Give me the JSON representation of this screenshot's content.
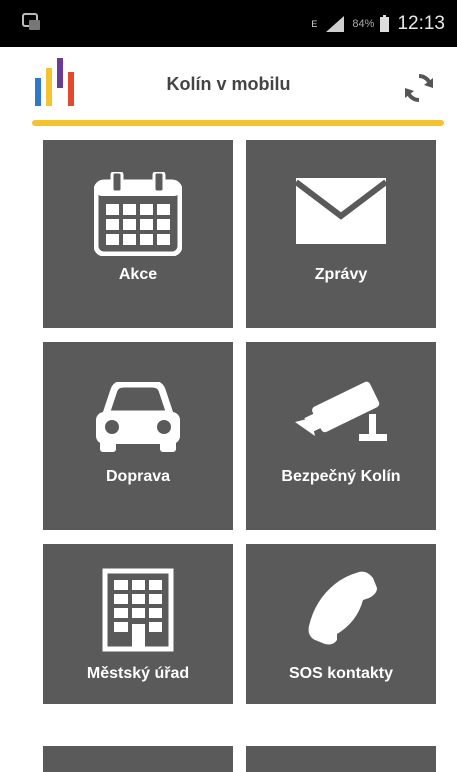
{
  "status_bar": {
    "network_indicator": "E",
    "battery_percent": "84%",
    "time": "12:13",
    "icons": [
      "notification-icon",
      "signal-icon",
      "battery-icon"
    ]
  },
  "app_bar": {
    "title": "Kolín v mobilu",
    "logo_icon": "city-logo-icon",
    "refresh_icon": "refresh-icon",
    "accent_color": "#f4c430"
  },
  "tiles": [
    {
      "label": "Akce",
      "icon": "calendar-icon"
    },
    {
      "label": "Zprávy",
      "icon": "envelope-icon"
    },
    {
      "label": "Doprava",
      "icon": "car-icon"
    },
    {
      "label": "Bezpečný Kolín",
      "icon": "security-camera-icon"
    },
    {
      "label": "Městský úřad",
      "icon": "building-icon"
    },
    {
      "label": "SOS kontakty",
      "icon": "phone-icon"
    }
  ],
  "colors": {
    "tile_background": "#5a5a5a",
    "status_bar": "#000000"
  }
}
